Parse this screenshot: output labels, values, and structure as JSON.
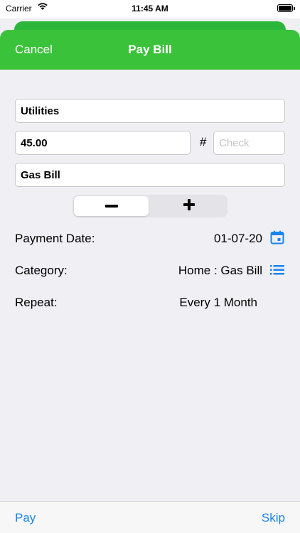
{
  "status_bar": {
    "carrier": "Carrier",
    "time": "11:45 AM",
    "wifi_icon": "wifi-icon",
    "battery_icon": "battery-icon"
  },
  "nav": {
    "cancel_label": "Cancel",
    "title": "Pay Bill",
    "color": "#3ac23b"
  },
  "form": {
    "payee_value": "Utilities",
    "amount_value": "45.00",
    "hash_label": "#",
    "check_placeholder": "Check",
    "memo_value": "Gas Bill"
  },
  "stepper": {
    "minus_icon": "minus-icon",
    "plus_icon": "plus-icon"
  },
  "rows": {
    "payment_date_label": "Payment Date:",
    "payment_date_value": "01-07-20",
    "category_label": "Category:",
    "category_value": "Home : Gas Bill",
    "repeat_label": "Repeat:",
    "repeat_value": "Every 1 Month"
  },
  "toolbar": {
    "pay_label": "Pay",
    "skip_label": "Skip",
    "accent": "#1a84ec"
  }
}
